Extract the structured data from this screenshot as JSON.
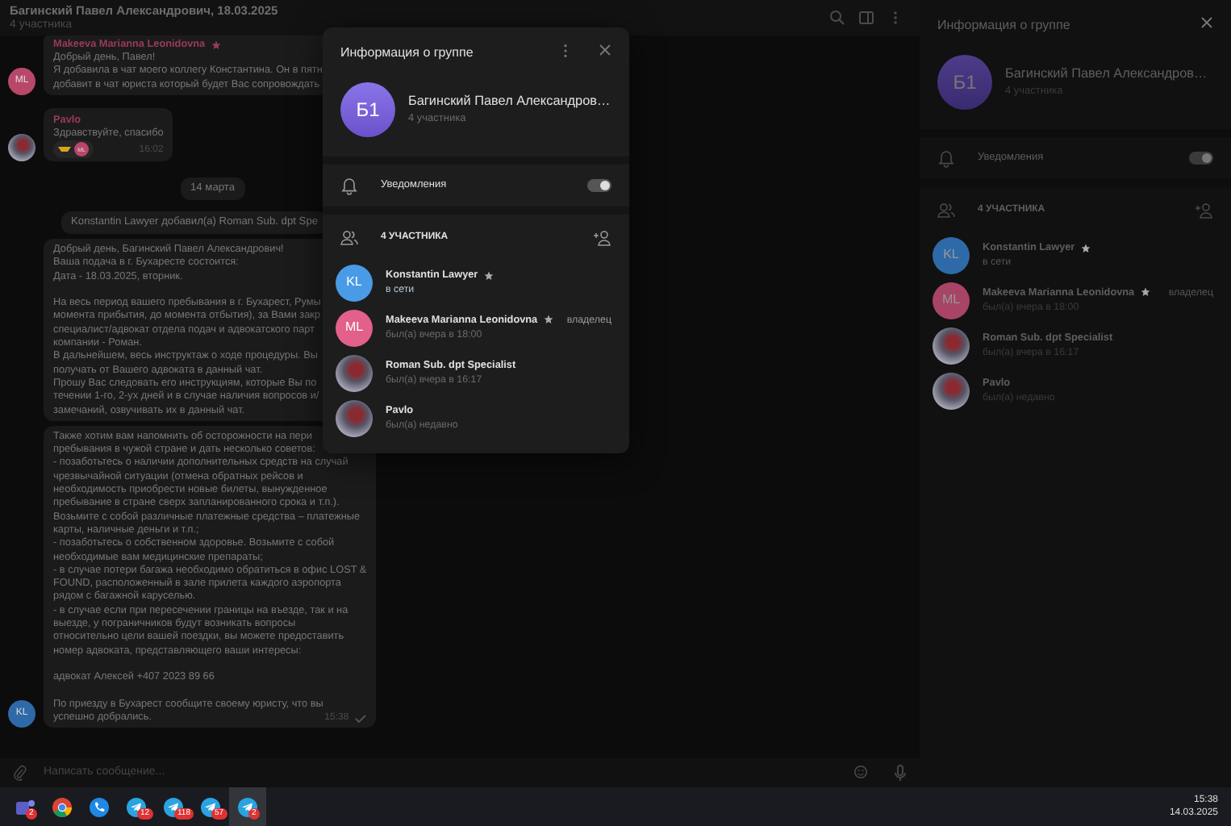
{
  "chat": {
    "title": "Багинский Павел Александрович, 18.03.2025",
    "subtitle": "4 участника",
    "messages": [
      {
        "kind": "incoming",
        "sender": "Makeeva Marianna Leonidovna",
        "star": true,
        "avatar": {
          "kind": "initials",
          "initials": "ML",
          "color": "#b8486a"
        },
        "paragraphs": [
          [
            "Добрый день, Павел!",
            "Я добавила в чат моего коллегу Константина. Он в пятн",
            "добавит в чат юриста который будет Вас сопровождать"
          ]
        ]
      },
      {
        "kind": "incoming",
        "sender": "Pavlo",
        "avatar": {
          "kind": "photo"
        },
        "paragraphs": [
          [
            "Здравствуйте, спасибо"
          ]
        ],
        "reaction": {
          "initials": "ML",
          "color": "#b8486a"
        },
        "time": "16:02"
      },
      {
        "kind": "date",
        "text": "14 марта"
      },
      {
        "kind": "service",
        "text": "Konstantin Lawyer добавил(а) Roman Sub. dpt Spe"
      },
      {
        "kind": "incoming",
        "paragraphs": [
          [
            "Добрый день, Багинский Павел Александрович!",
            "Ваша подача в г. Бухаресте состоится:",
            "Дата - 18.03.2025, вторник."
          ],
          [
            "На весь период вашего пребывания в г. Бухарест, Румы",
            "момента прибытия, до момента отбытия), за Вами закр",
            "специалист/адвокат отдела подач и адвокатского парт",
            "компании - Роман.",
            "В дальнейшем, весь инструктаж о ходе процедуры. Вы",
            "получать от Вашего адвоката в данный чат.",
            "Прошу Вас следовать его инструкциям, которые Вы по",
            "течении 1-го, 2-ух дней и в случае наличия вопросов и/",
            "замечаний, озвучивать их в данный чат."
          ]
        ]
      },
      {
        "kind": "incoming",
        "avatar": {
          "kind": "initials",
          "initials": "KL",
          "color": "#2f6aa8"
        },
        "paragraphs": [
          [
            "Также хотим вам напомнить об осторожности на пери",
            "пребывания в чужой стране и дать несколько советов:",
            "- позаботьтесь о наличии дополнительных средств на случай",
            "чрезвычайной ситуации (отмена обратных рейсов и",
            "необходимость приобрести новые билеты, вынужденное",
            "пребывание в стране сверх запланированного срока и т.п.).",
            "Возьмите с собой различные платежные средства – платежные",
            "карты, наличные деньги и т.п.;",
            "- позаботьтесь о собственном здоровье. Возьмите с собой",
            "необходимые вам медицинские препараты;",
            "- в случае потери багажа необходимо обратиться в офис LOST &",
            "FOUND, расположенный в зале прилета каждого аэропорта",
            "рядом с багажной каруселью.",
            "- в случае если при пересечении границы на въезде, так и на",
            "выезде, у пограничников будут возникать вопросы",
            "относительно цели вашей поездки, вы можете предоставить",
            "номер адвоката, представляющего ваши интересы:"
          ],
          [
            "адвокат Алексей +407 2023 89 66"
          ],
          [
            "По приезду в Бухарест сообщите своему юристу, что вы",
            "успешно добрались."
          ]
        ],
        "time": "15:38",
        "read": true
      }
    ],
    "composer": {
      "placeholder": "Написать сообщение..."
    }
  },
  "group_info_dialog": {
    "title": "Информация о группе",
    "avatar": {
      "initials": "Б1"
    },
    "name": "Багинский Павел Александров…",
    "subtitle": "4 участника",
    "notifications": {
      "label": "Уведомления",
      "on": true
    },
    "members_header": "4 УЧАСТНИКА",
    "members": [
      {
        "name": "Konstantin Lawyer",
        "star": true,
        "status": "в сети",
        "online": true,
        "avatar": {
          "kind": "initials",
          "initials": "KL",
          "color": "#4a9be6"
        }
      },
      {
        "name": "Makeeva Marianna Leonidovna",
        "star": true,
        "role": "владелец",
        "status": "был(а) вчера в 18:00",
        "online": false,
        "avatar": {
          "kind": "initials",
          "initials": "ML",
          "color": "#e2608a"
        }
      },
      {
        "name": "Roman Sub. dpt Specialist",
        "star": false,
        "status": "был(а) вчера в 16:17",
        "online": false,
        "avatar": {
          "kind": "photo"
        }
      },
      {
        "name": "Pavlo",
        "star": false,
        "status": "был(а) недавно",
        "online": false,
        "avatar": {
          "kind": "photo"
        }
      }
    ]
  },
  "side_panel": {
    "title": "Информация о группе",
    "avatar": {
      "initials": "Б1"
    },
    "name": "Багинский Павел Александров…",
    "subtitle": "4 участника",
    "notifications": {
      "label": "Уведомления",
      "on": true
    },
    "members_header": "4 УЧАСТНИКА",
    "members": [
      {
        "name": "Konstantin Lawyer",
        "star": true,
        "status": "в сети",
        "online": true,
        "avatar": {
          "kind": "initials",
          "initials": "KL",
          "color": "#2f6aa8"
        }
      },
      {
        "name": "Makeeva Marianna Leonidovna",
        "star": true,
        "role": "владелец",
        "status": "был(а) вчера в 18:00",
        "online": false,
        "avatar": {
          "kind": "initials",
          "initials": "ML",
          "color": "#a84466"
        }
      },
      {
        "name": "Roman Sub. dpt Specialist",
        "star": false,
        "status": "был(а) вчера в 16:17",
        "online": false,
        "avatar": {
          "kind": "photo"
        }
      },
      {
        "name": "Pavlo",
        "star": false,
        "status": "был(а) недавно",
        "online": false,
        "avatar": {
          "kind": "photo"
        }
      }
    ]
  },
  "taskbar": {
    "apps": [
      {
        "kind": "teams",
        "badge": "2",
        "selected": false
      },
      {
        "kind": "chrome",
        "selected": false
      },
      {
        "kind": "phone",
        "selected": false
      },
      {
        "kind": "telegram",
        "badge": "12",
        "selected": false
      },
      {
        "kind": "telegram",
        "badge": "118",
        "selected": false
      },
      {
        "kind": "telegram",
        "badge": "57",
        "selected": false
      },
      {
        "kind": "telegram",
        "badge": "2",
        "selected": true
      }
    ],
    "time": "15:38",
    "date": "14.03.2025"
  }
}
